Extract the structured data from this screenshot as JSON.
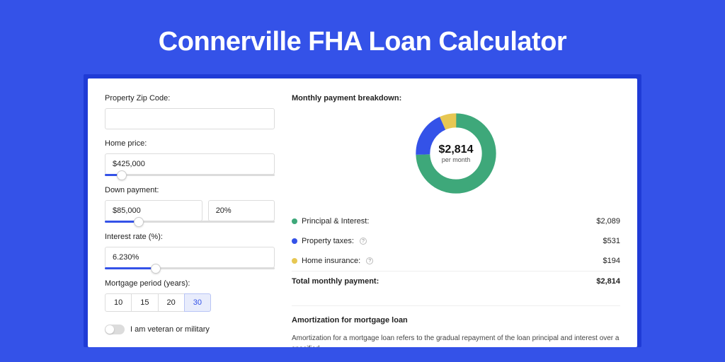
{
  "title": "Connerville FHA Loan Calculator",
  "form": {
    "zip_label": "Property Zip Code:",
    "zip_value": "",
    "home_price_label": "Home price:",
    "home_price_value": "$425,000",
    "home_price_slider_pct": 10,
    "down_payment_label": "Down payment:",
    "down_payment_value": "$85,000",
    "down_payment_pct": "20%",
    "down_payment_slider_pct": 20,
    "interest_label": "Interest rate (%):",
    "interest_value": "6.230%",
    "interest_slider_pct": 30,
    "period_label": "Mortgage period (years):",
    "period_options": [
      "10",
      "15",
      "20",
      "30"
    ],
    "period_selected": "30",
    "veteran_label": "I am veteran or military"
  },
  "breakdown": {
    "heading": "Monthly payment breakdown:",
    "center_amount": "$2,814",
    "center_caption": "per month",
    "items": [
      {
        "label": "Principal & Interest:",
        "amount": "$2,089",
        "color": "green",
        "help": false
      },
      {
        "label": "Property taxes:",
        "amount": "$531",
        "color": "blue",
        "help": true
      },
      {
        "label": "Home insurance:",
        "amount": "$194",
        "color": "yellow",
        "help": true
      }
    ],
    "total_label": "Total monthly payment:",
    "total_amount": "$2,814"
  },
  "amort": {
    "heading": "Amortization for mortgage loan",
    "text": "Amortization for a mortgage loan refers to the gradual repayment of the loan principal and interest over a specified"
  },
  "chart_data": {
    "type": "pie",
    "title": "Monthly payment breakdown",
    "series": [
      {
        "name": "Principal & Interest",
        "value": 2089,
        "color": "#3ea87a"
      },
      {
        "name": "Property taxes",
        "value": 531,
        "color": "#3452e8"
      },
      {
        "name": "Home insurance",
        "value": 194,
        "color": "#e7c752"
      }
    ],
    "total": 2814,
    "unit": "USD per month"
  }
}
